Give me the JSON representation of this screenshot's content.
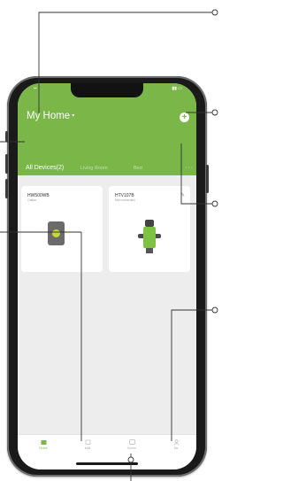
{
  "header": {
    "title": "My Home",
    "caret": "▾",
    "add_symbol": "+"
  },
  "tabs": {
    "all_devices": "All Devices(2)",
    "tab2": "Living Room",
    "tab3": "Bed",
    "more": "···"
  },
  "devices": [
    {
      "name": "HW500WB",
      "status": "Online",
      "icon": "gateway-hub-icon"
    },
    {
      "name": "HTV107B",
      "status": "Not connected",
      "icon": "water-timer-icon",
      "edit_symbol": "✎"
    }
  ],
  "bottom_nav": [
    {
      "label": "Home",
      "icon": "house-icon",
      "active": true
    },
    {
      "label": "Mall",
      "icon": "shop-icon",
      "active": false
    },
    {
      "label": "Scene",
      "icon": "scene-icon",
      "active": false
    },
    {
      "label": "Me",
      "icon": "person-icon",
      "active": false
    }
  ],
  "colors": {
    "brand_green": "#7ab648",
    "screen_bg": "#ededed",
    "phone_frame": "#1a1a1a",
    "callout_line": "#333333"
  }
}
